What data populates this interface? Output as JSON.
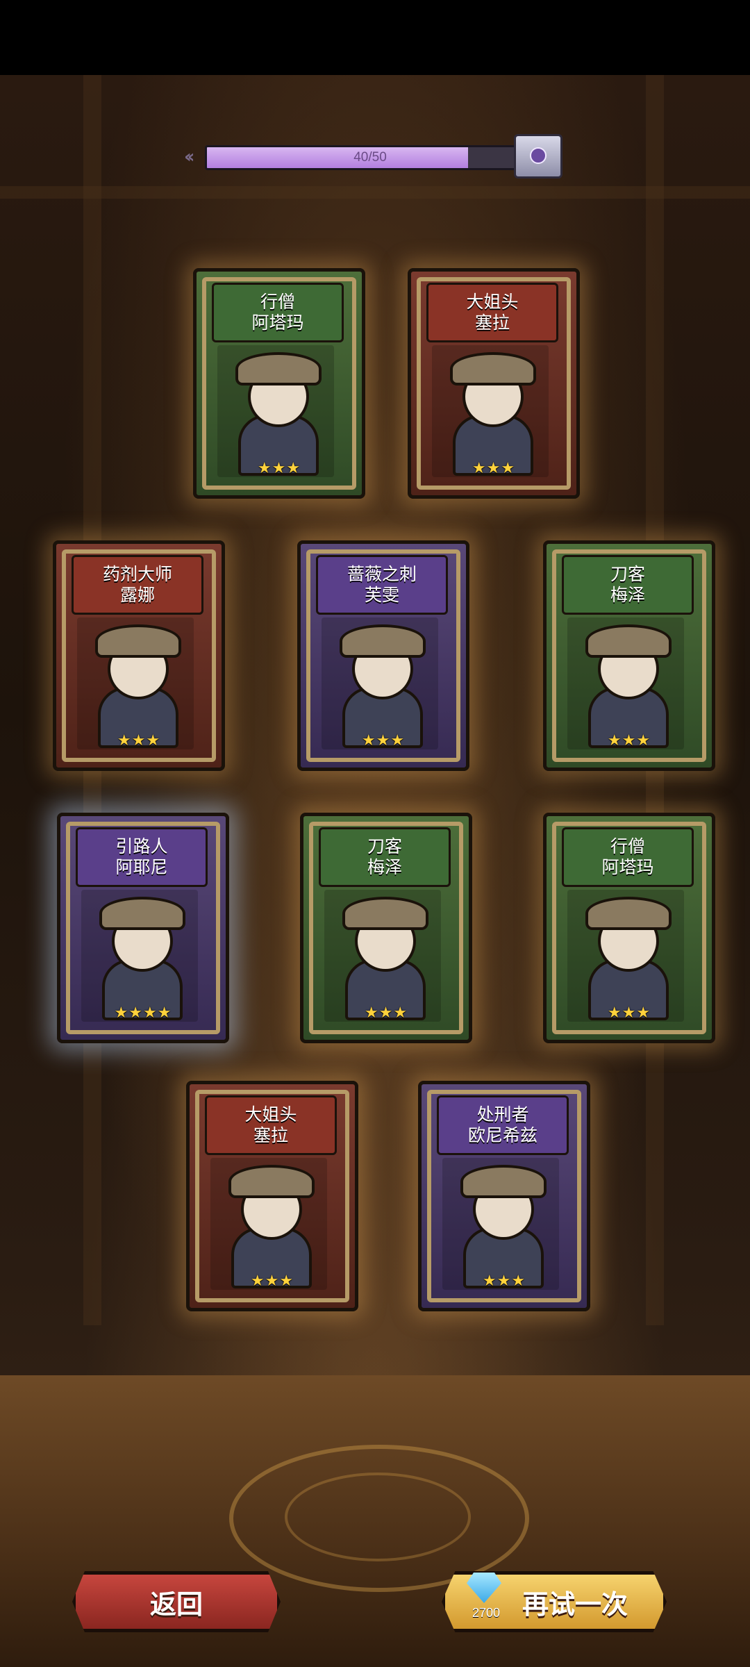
{
  "progress": {
    "text": "40/50",
    "fraction": 0.8
  },
  "cards": [
    {
      "title1": "行僧",
      "title2": "阿塔玛",
      "stars": "★★★",
      "color": "green"
    },
    {
      "title1": "大姐头",
      "title2": "塞拉",
      "stars": "★★★",
      "color": "red"
    },
    {
      "title1": "药剂大师",
      "title2": "露娜",
      "stars": "★★★",
      "color": "red"
    },
    {
      "title1": "蔷薇之刺",
      "title2": "芙雯",
      "stars": "★★★",
      "color": "purple"
    },
    {
      "title1": "刀客",
      "title2": "梅泽",
      "stars": "★★★",
      "color": "green"
    },
    {
      "title1": "引路人",
      "title2": "阿耶尼",
      "stars": "★★★★",
      "color": "purple"
    },
    {
      "title1": "刀客",
      "title2": "梅泽",
      "stars": "★★★",
      "color": "green"
    },
    {
      "title1": "行僧",
      "title2": "阿塔玛",
      "stars": "★★★",
      "color": "green"
    },
    {
      "title1": "大姐头",
      "title2": "塞拉",
      "stars": "★★★",
      "color": "red"
    },
    {
      "title1": "处刑者",
      "title2": "欧尼希兹",
      "stars": "★★★",
      "color": "purple"
    }
  ],
  "buttons": {
    "back_label": "返回",
    "retry_label": "再试一次",
    "retry_cost": "2700",
    "retry_cost_icon": "diamond-icon"
  }
}
